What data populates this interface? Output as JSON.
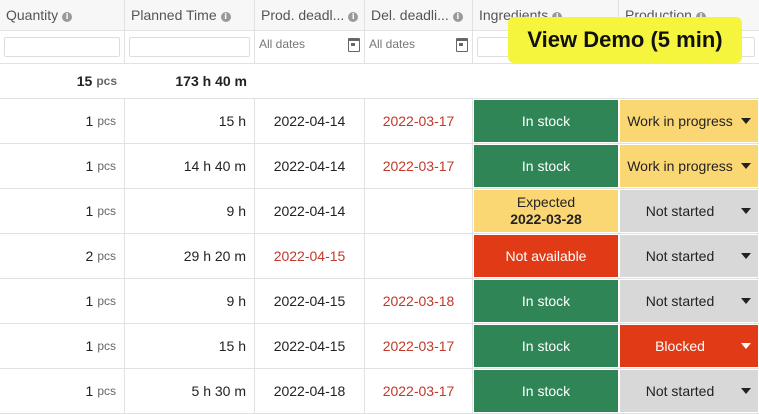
{
  "columns": [
    {
      "label": "Quantity"
    },
    {
      "label": "Planned Time"
    },
    {
      "label": "Prod. deadl..."
    },
    {
      "label": "Del. deadli..."
    },
    {
      "label": "Ingredients"
    },
    {
      "label": "Production"
    }
  ],
  "filters": {
    "date_placeholder_prod": "All dates",
    "date_placeholder_del": "All dates"
  },
  "totals": {
    "quantity": "15",
    "quantity_unit": "pcs",
    "planned_time": "173 h 40 m"
  },
  "rows": [
    {
      "qty": "1",
      "unit": "pcs",
      "time": "15 h",
      "prod": "2022-04-14",
      "prod_late": false,
      "del": "2022-03-17",
      "ing": "In stock",
      "ing_sub": "",
      "ing_color": "green",
      "status": "Work in progress",
      "status_color": "yellow"
    },
    {
      "qty": "1",
      "unit": "pcs",
      "time": "14 h 40 m",
      "prod": "2022-04-14",
      "prod_late": false,
      "del": "2022-03-17",
      "ing": "In stock",
      "ing_sub": "",
      "ing_color": "green",
      "status": "Work in progress",
      "status_color": "yellow"
    },
    {
      "qty": "1",
      "unit": "pcs",
      "time": "9 h",
      "prod": "2022-04-14",
      "prod_late": false,
      "del": "",
      "ing": "Expected",
      "ing_sub": "2022-03-28",
      "ing_color": "yellow",
      "status": "Not started",
      "status_color": "grey"
    },
    {
      "qty": "2",
      "unit": "pcs",
      "time": "29 h 20 m",
      "prod": "2022-04-15",
      "prod_late": true,
      "del": "",
      "ing": "Not available",
      "ing_sub": "",
      "ing_color": "red",
      "status": "Not started",
      "status_color": "grey"
    },
    {
      "qty": "1",
      "unit": "pcs",
      "time": "9 h",
      "prod": "2022-04-15",
      "prod_late": false,
      "del": "2022-03-18",
      "ing": "In stock",
      "ing_sub": "",
      "ing_color": "green",
      "status": "Not started",
      "status_color": "grey"
    },
    {
      "qty": "1",
      "unit": "pcs",
      "time": "15 h",
      "prod": "2022-04-15",
      "prod_late": false,
      "del": "2022-03-17",
      "ing": "In stock",
      "ing_sub": "",
      "ing_color": "green",
      "status": "Blocked",
      "status_color": "red"
    },
    {
      "qty": "1",
      "unit": "pcs",
      "time": "5 h 30 m",
      "prod": "2022-04-18",
      "prod_late": false,
      "del": "2022-03-17",
      "ing": "In stock",
      "ing_sub": "",
      "ing_color": "green",
      "status": "Not started",
      "status_color": "grey"
    }
  ],
  "demo_button": {
    "label": "View Demo (5 min)"
  },
  "colors": {
    "green": "#2f8556",
    "yellow": "#fbd774",
    "red": "#e03a17",
    "grey": "#d8d8d8",
    "late_text": "#c0392b",
    "demo_bg": "#f5f53d"
  }
}
